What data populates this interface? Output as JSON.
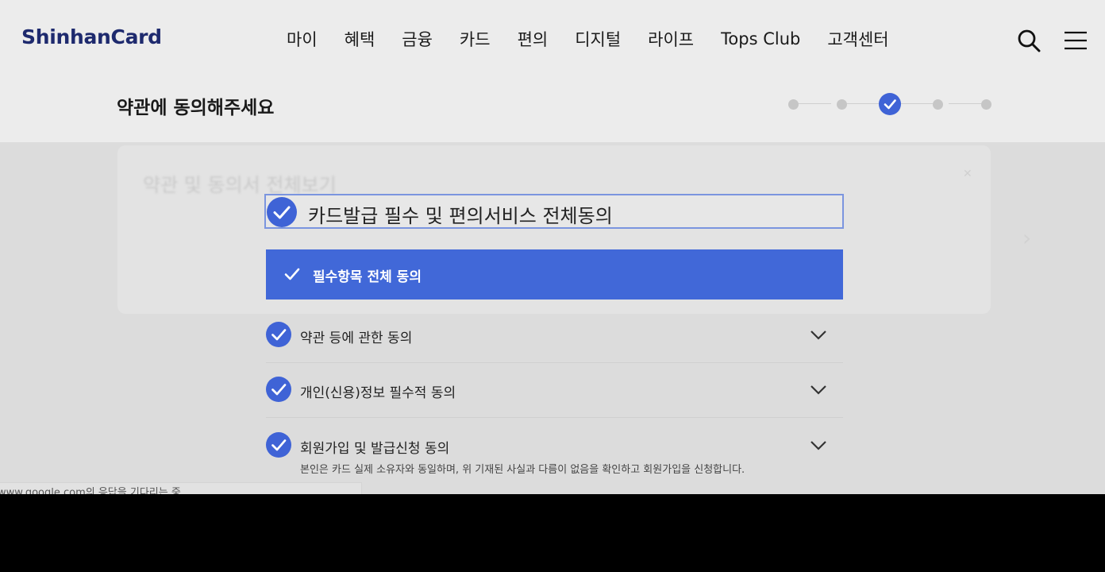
{
  "header": {
    "logo": "ShinhanCard",
    "nav": [
      "마이",
      "혜택",
      "금융",
      "카드",
      "편의",
      "디지털",
      "라이프",
      "Tops Club",
      "고객센터"
    ],
    "icons": [
      "search-icon",
      "hamburger-menu-icon"
    ]
  },
  "step": {
    "title": "약관에 동의해주세요",
    "total_steps": 5,
    "current_step": 3
  },
  "background_card": {
    "title": "약관 및 동의서 전체보기"
  },
  "consent": {
    "all_agree_label": "카드발급 필수 및 편의서비스 전체동의",
    "required_all_label": "필수항목 전체 동의",
    "items": [
      {
        "label": "약관 등에 관한 동의",
        "checked": true
      },
      {
        "label": "개인(신용)정보 필수적 동의",
        "checked": true
      },
      {
        "label": "회원가입 및 발급신청 동의",
        "checked": true
      }
    ],
    "membership_desc": "본인은 카드 실제 소유자와 동일하며, 위 기재된 사실과 다름이 없음을 확인하고 회원가입을 신청합니다."
  },
  "status_bar": {
    "text": "www.google.com의 응답을 기다리는 중..."
  },
  "colors": {
    "accent": "#4168d8",
    "logo": "#1e2a6e",
    "page_bg": "#e9e9e9"
  }
}
